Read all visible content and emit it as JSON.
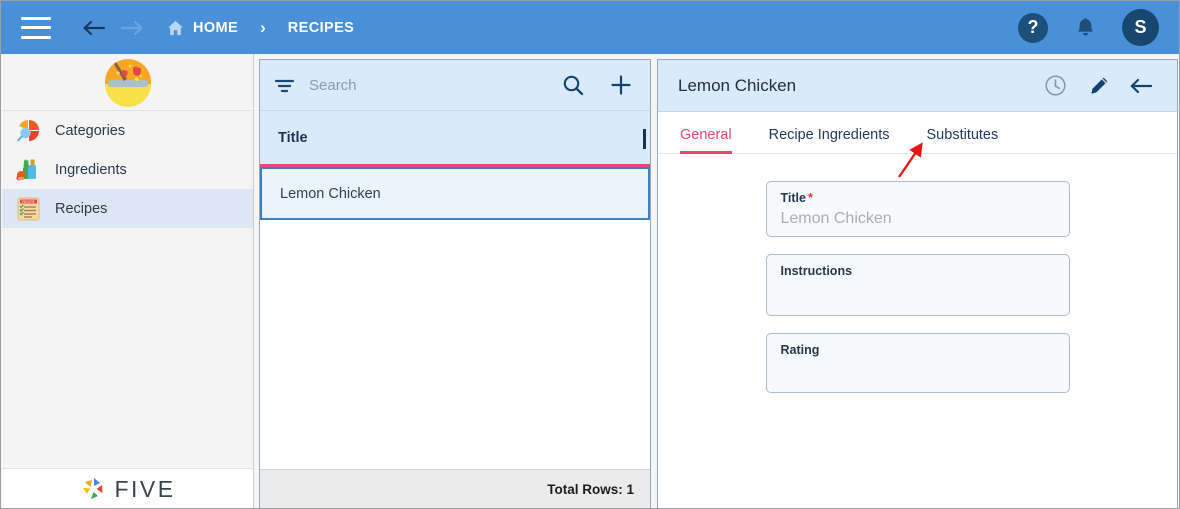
{
  "appbar": {
    "menu_icon": "hamburger-icon",
    "back_icon": "arrow-left-icon",
    "forward_icon": "arrow-right-icon",
    "home_icon": "home-icon",
    "breadcrumb": [
      {
        "label": "HOME"
      },
      {
        "label": "RECIPES"
      }
    ],
    "separator": "›",
    "help_icon": "help-circle-icon",
    "help_label": "?",
    "bell_icon": "bell-icon",
    "avatar_initial": "S",
    "bg_color": "#4a90d9"
  },
  "sidebar": {
    "logo_icon": "salad-bowl-logo",
    "items": [
      {
        "label": "Categories",
        "icon": "pie-chart-search-icon",
        "active": false
      },
      {
        "label": "Ingredients",
        "icon": "groceries-icon",
        "active": false
      },
      {
        "label": "Recipes",
        "icon": "recipe-card-icon",
        "active": true
      }
    ],
    "brand": {
      "name": "FIVE",
      "mark_icon": "five-pinwheel-icon"
    }
  },
  "list_panel": {
    "search": {
      "placeholder": "Search",
      "value": "",
      "filter_icon": "filter-icon",
      "search_icon": "search-icon",
      "add_icon": "plus-icon"
    },
    "columns": [
      "Title"
    ],
    "rows": [
      {
        "title": "Lemon Chicken",
        "selected": true
      }
    ],
    "footer_text": "Total Rows: 1",
    "accent_color": "#e8486b"
  },
  "detail_panel": {
    "title": "Lemon Chicken",
    "actions": [
      {
        "name": "history-icon"
      },
      {
        "name": "edit-pencil-icon"
      },
      {
        "name": "back-arrow-icon"
      }
    ],
    "tabs": [
      {
        "label": "General",
        "active": true
      },
      {
        "label": "Recipe Ingredients",
        "active": false
      },
      {
        "label": "Substitutes",
        "active": false
      }
    ],
    "fields": [
      {
        "label": "Title",
        "required": true,
        "value": "Lemon Chicken"
      },
      {
        "label": "Instructions",
        "required": false,
        "value": ""
      },
      {
        "label": "Rating",
        "required": false,
        "value": ""
      }
    ]
  },
  "annotation": {
    "type": "arrow",
    "color": "#ee1111",
    "points_to": "Substitutes"
  }
}
